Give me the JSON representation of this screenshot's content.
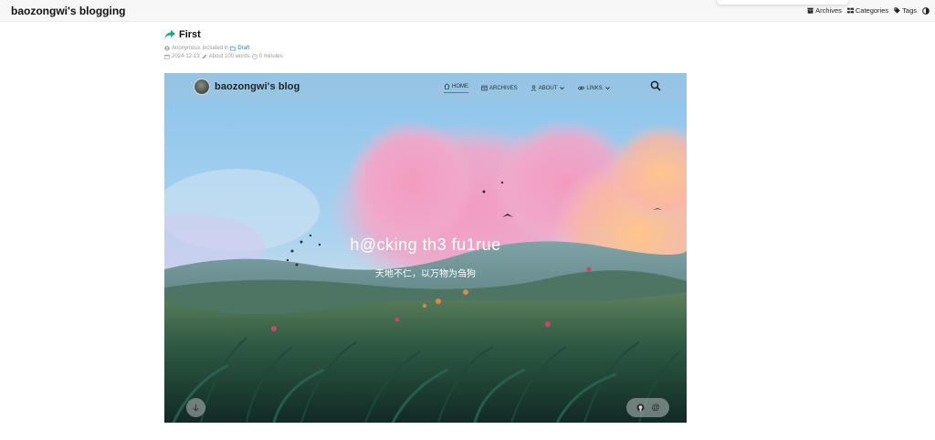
{
  "site": {
    "title": "baozongwi's blogging"
  },
  "top_nav": [
    {
      "label": "Archives",
      "icon": "archive-icon"
    },
    {
      "label": "Categories",
      "icon": "categories-icon"
    },
    {
      "label": "Tags",
      "icon": "tag-icon"
    }
  ],
  "post": {
    "title": "First",
    "author": "Anonymous",
    "included_in": "included in",
    "category": "Draft",
    "date": "2024-12-13",
    "words": "About 100 words",
    "reading_time": "0 minutes"
  },
  "embedded": {
    "brand": "baozongwi's blog",
    "menu": [
      {
        "label": "HOME",
        "icon": "home-icon",
        "active": true
      },
      {
        "label": "ARCHIVES",
        "icon": "archive-icon",
        "active": false
      },
      {
        "label": "ABOUT",
        "icon": "user-icon",
        "active": false
      },
      {
        "label": "LINKS",
        "icon": "link-icon",
        "active": false
      }
    ],
    "hero_title": "h@cking th3 fu1rue",
    "hero_subtitle": "天地不仁，以万物为刍狗",
    "social_at": "@"
  },
  "colors": {
    "accent_link": "#2f80c1",
    "title_arrow": "#19a974",
    "active_underline": "#c24a6a"
  }
}
